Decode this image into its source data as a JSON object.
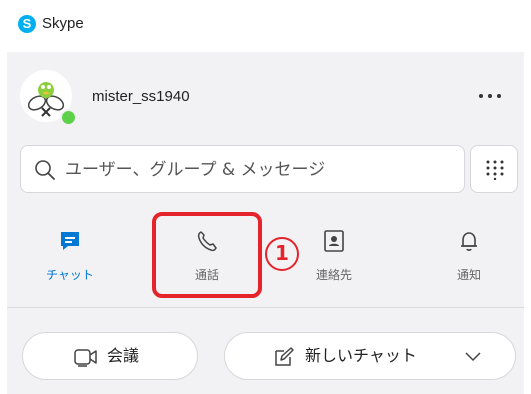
{
  "app": {
    "title": "Skype",
    "logo_letter": "S"
  },
  "profile": {
    "username": "mister_ss1940"
  },
  "search": {
    "placeholder": "ユーザー、グループ & メッセージ"
  },
  "tabs": [
    {
      "label": "チャット",
      "active": true
    },
    {
      "label": "通話",
      "active": false
    },
    {
      "label": "連絡先",
      "active": false
    },
    {
      "label": "通知",
      "active": false
    }
  ],
  "annotation": {
    "number": "1"
  },
  "actions": {
    "meeting_label": "会議",
    "new_chat_label": "新しいチャット"
  },
  "colors": {
    "accent": "#0078d4",
    "highlight": "#e5232a",
    "presence": "#5ed14b",
    "skype_blue": "#00aff0"
  }
}
